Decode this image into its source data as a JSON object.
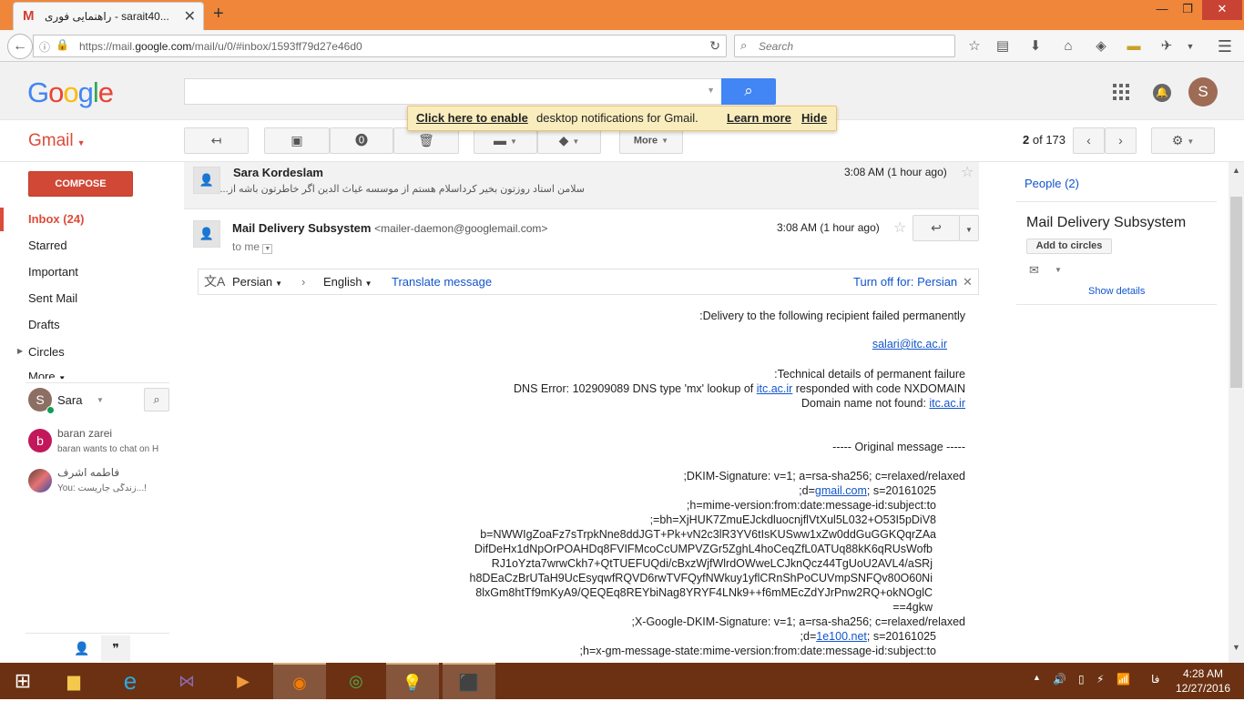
{
  "browser": {
    "tab_title": "راهنمایی فوری - sarait40...",
    "tab_close": "✕",
    "new_tab": "+",
    "url_host_prefix": "https://mail.",
    "url_host": "google.com",
    "url_path": "/mail/u/0/#inbox/1593ff79d27e46d0",
    "search_placeholder": "Search",
    "window_buttons": [
      "—",
      "❐",
      "✕"
    ]
  },
  "gmail": {
    "logo": "Google",
    "account_initial": "S",
    "label": "Gmail",
    "notification": {
      "link": "Click here to enable",
      "text": "desktop notifications for Gmail.",
      "learn_more": "Learn more",
      "hide": "Hide"
    },
    "toolbar": {
      "more": "More",
      "counter_current": "2",
      "counter_of": "of 173"
    },
    "compose": "COMPOSE",
    "nav": [
      "Inbox (24)",
      "Starred",
      "Important",
      "Sent Mail",
      "Drafts",
      "Circles",
      "More"
    ],
    "chat": {
      "self_initial": "S",
      "self_name": "Sara",
      "contacts": [
        {
          "initial": "b",
          "name": "baran zarei",
          "status": "baran wants to chat on H"
        },
        {
          "name": "فاطمه اشرف",
          "status": "You: زندگی جاریست...!"
        }
      ]
    }
  },
  "thread": {
    "prev": {
      "sender": "Sara Kordeslam",
      "time": "3:08 AM (1 hour ago)",
      "snippet": "سلامن استاد روزتون بخیر کرداسلام هستم از موسسه غیاث الدین اگر خاطرتون باشه از..."
    },
    "msg": {
      "sender": "Mail Delivery Subsystem",
      "email": "<mailer-daemon@googlemail.com>",
      "to": "to me",
      "time": "3:08 AM (1 hour ago)"
    },
    "translate": {
      "from": "Persian",
      "to": "English",
      "action": "Translate message",
      "turn_off": "Turn off for: Persian"
    },
    "body": {
      "l1": ":Delivery to the following recipient failed permanently",
      "recipient": "salari@itc.ac.ir",
      "l2": ":Technical details of permanent failure",
      "l3a": "DNS Error: 102909089 DNS type 'mx' lookup of ",
      "l3link": "itc.ac.ir",
      "l3b": " responded with code NXDOMAIN",
      "l4a": "Domain name not found: ",
      "l4link": "itc.ac.ir",
      "l5": "----- Original message -----",
      "l6": ";DKIM-Signature: v=1; a=rsa-sha256; c=relaxed/relaxed",
      "l7a": ";d=",
      "l7link": "gmail.com",
      "l7b": "; s=20161025",
      "l8": ";h=mime-version:from:date:message-id:subject:to",
      "l9": ";=bh=XjHUK7ZmuEJckdluocnjflVtXul5L032+O53I5pDiV8",
      "l10": "b=NWWIgZoaFz7sTrpkNne8ddJGT+Pk+vN2c3lR3YV6tIsKUSww1xZw0ddGuGGKQqrZAa",
      "l11": "DifDeHx1dNpOrPOAHDq8FVIFMcoCcUMPVZGr5ZghL4hoCeqZfL0ATUq88kK6qRUsWofb",
      "l12": "RJ1oYzta7wrwCkh7+QtTUEFUQdi/cBxzWjfWlrdOWweLCJknQcz44TgUoU2AVL4/aSRj",
      "l13": "h8DEaCzBrUTaH9UcEsyqwfRQVD6rwTVFQyfNWkuy1yflCRnShPoCUVmpSNFQv80O60Ni",
      "l14": "8lxGm8htTf9mKyA9/QEQEq8REYbiNag8YRYF4LNk9++f6mMEcZdYJrPnw2RQ+okNOglC",
      "l15": "==4gkw",
      "l16": ";X-Google-DKIM-Signature: v=1; a=rsa-sha256; c=relaxed/relaxed",
      "l17a": ";d=",
      "l17link": "1e100.net",
      "l17b": "; s=20161025",
      "l18": ";h=x-gm-message-state:mime-version:from:date:message-id:subject:to"
    }
  },
  "people": {
    "header": "People (2)",
    "name": "Mail Delivery Subsystem",
    "add": "Add to circles",
    "show_details": "Show details"
  },
  "taskbar": {
    "lang": "فا",
    "time": "4:28 AM",
    "date": "12/27/2016"
  },
  "colors": {
    "firefox_tab": "#f0863a",
    "gmail_red": "#dd4b39",
    "search_blue": "#4285f4",
    "link_blue": "#1155cc",
    "taskbar": "#6b3112"
  }
}
